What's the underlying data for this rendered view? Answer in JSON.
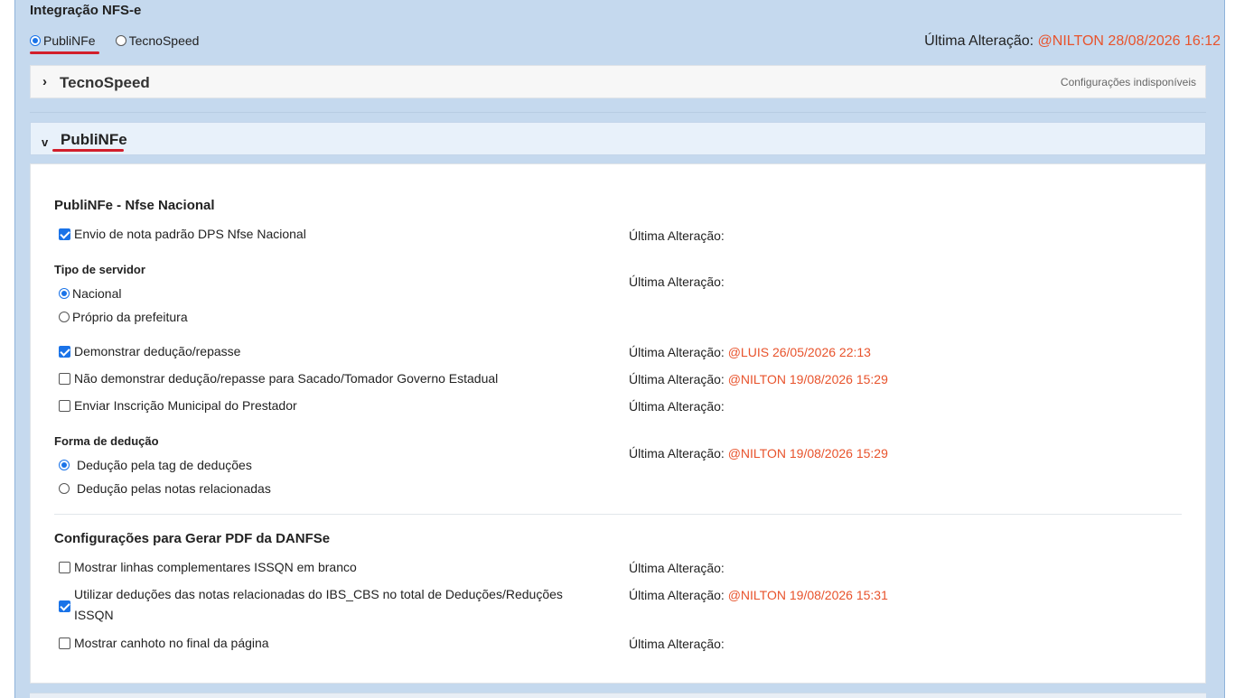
{
  "integration": {
    "title": "Integração NFS-e",
    "options": [
      {
        "label": "PubliNFe",
        "selected": true
      },
      {
        "label": "TecnoSpeed",
        "selected": false
      }
    ],
    "last_change_label": "Última Alteração:",
    "last_change_value": "@NILTON 28/08/2026 16:12"
  },
  "tecnospeed_panel": {
    "chevron": "›",
    "title": "TecnoSpeed",
    "note": "Configurações indisponíveis"
  },
  "publinfe_panel": {
    "chevron": "v",
    "title": "PubliNFe",
    "section1_title": "PubliNFe - Nfse Nacional",
    "envio_padrao": {
      "label": "Envio de nota padrão DPS Nfse Nacional",
      "checked": true,
      "alt_label": "Última Alteração:",
      "alt_value": ""
    },
    "tipo_servidor": {
      "title": "Tipo de servidor",
      "options": [
        {
          "label": "Nacional",
          "selected": true
        },
        {
          "label": "Próprio da prefeitura",
          "selected": false
        }
      ],
      "alt_label": "Última Alteração:",
      "alt_value": ""
    },
    "demonstrar": {
      "label": "Demonstrar dedução/repasse",
      "checked": true,
      "alt_label": "Última Alteração:",
      "alt_value": "@LUIS 26/05/2026 22:13"
    },
    "nao_demonstrar": {
      "label": "Não demonstrar dedução/repasse para Sacado/Tomador Governo Estadual",
      "checked": false,
      "alt_label": "Última Alteração:",
      "alt_value": "@NILTON 19/08/2026 15:29"
    },
    "enviar_inscricao": {
      "label": "Enviar Inscrição Municipal do Prestador",
      "checked": false,
      "alt_label": "Última Alteração:",
      "alt_value": ""
    },
    "forma_deducao": {
      "title": "Forma de dedução",
      "options": [
        {
          "label": "Dedução pela tag de deduções",
          "selected": true
        },
        {
          "label": "Dedução pelas notas relacionadas",
          "selected": false
        }
      ],
      "alt_label": "Última Alteração:",
      "alt_value": "@NILTON 19/08/2026 15:29"
    },
    "section2_title": "Configurações para Gerar PDF da DANFSe",
    "linhas_compl": {
      "label": "Mostrar linhas complementares ISSQN em branco",
      "checked": false,
      "alt_label": "Última Alteração:",
      "alt_value": ""
    },
    "utilizar_deducoes": {
      "label_line1": "Utilizar deduções das notas relacionadas do IBS_CBS no total de Deduções/Reduções",
      "label_line2": "ISSQN",
      "checked": true,
      "alt_label": "Última Alteração:",
      "alt_value": "@NILTON 19/08/2026 15:31"
    },
    "canhoto": {
      "label": "Mostrar canhoto no final da página",
      "checked": false,
      "alt_label": "Última Alteração:",
      "alt_value": ""
    }
  },
  "colors": {
    "accent": "#1a73e8",
    "change_user": "#e8532c",
    "underline": "#d21e2b",
    "frame": "#c5d9ee"
  }
}
